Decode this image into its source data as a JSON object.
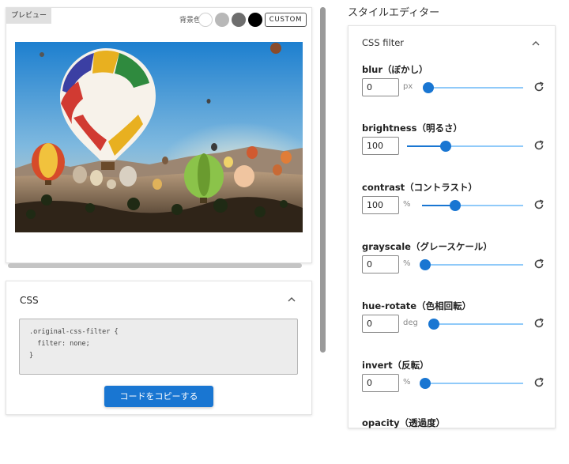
{
  "preview": {
    "badge": "プレビュー",
    "background_label": "背景色",
    "swatches": [
      {
        "name": "white",
        "color": "#ffffff"
      },
      {
        "name": "light-gray",
        "color": "#b8b8b8"
      },
      {
        "name": "dark-gray",
        "color": "#6e6e6e"
      },
      {
        "name": "black",
        "color": "#000000"
      }
    ],
    "custom_label": "CUSTOM"
  },
  "css_panel": {
    "title": "CSS",
    "code_lines": [
      ".original-css-filter {",
      "  filter: none;",
      "}"
    ],
    "copy_label": "コードをコピーする"
  },
  "editor": {
    "title": "スタイルエディター",
    "section_title": "CSS filter",
    "filters": [
      {
        "label": "blur（ぼかし）",
        "value": "0",
        "unit": "px",
        "fraction": 0.0
      },
      {
        "label": "brightness（明るさ）",
        "value": "100",
        "unit": "",
        "fraction": 0.33
      },
      {
        "label": "contrast（コントラスト）",
        "value": "100",
        "unit": "%",
        "fraction": 0.33
      },
      {
        "label": "grayscale（グレースケール）",
        "value": "0",
        "unit": "%",
        "fraction": 0.0
      },
      {
        "label": "hue-rotate（色相回転）",
        "value": "0",
        "unit": "deg",
        "fraction": 0.0
      },
      {
        "label": "invert（反転）",
        "value": "0",
        "unit": "%",
        "fraction": 0.0
      },
      {
        "label": "opacity（透過度）",
        "value": "",
        "unit": "",
        "fraction": 0.0
      }
    ]
  },
  "colors": {
    "accent": "#1976d2",
    "track": "#90caf9"
  }
}
